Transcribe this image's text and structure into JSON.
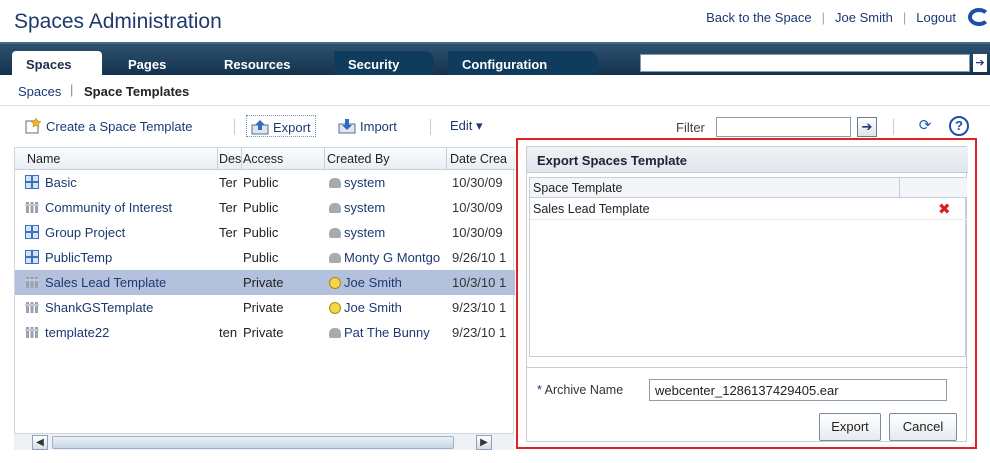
{
  "app": {
    "title": "Spaces Administration"
  },
  "header": {
    "links": [
      "Back to the Space",
      "Joe Smith",
      "Logout"
    ]
  },
  "tabs": [
    {
      "label": "Spaces"
    },
    {
      "label": "Pages"
    },
    {
      "label": "Resources"
    },
    {
      "label": "Security"
    },
    {
      "label": "Configuration"
    }
  ],
  "breadcrumb": {
    "parent": "Spaces",
    "current": "Space Templates"
  },
  "toolbar": {
    "create_label": "Create a Space Template",
    "export_label": "Export",
    "import_label": "Import",
    "edit_label": "Edit ▾",
    "filter_label": "Filter",
    "filter_value": ""
  },
  "table": {
    "columns": [
      "Name",
      "Des",
      "Access",
      "Created By",
      "Date Crea"
    ],
    "rows": [
      {
        "name": "Basic",
        "desc": "Ter",
        "access": "Public",
        "created_by": "system",
        "date": "10/30/09",
        "icon": "space-template-icon",
        "selected": false
      },
      {
        "name": "Community of Interest",
        "desc": "Ter",
        "access": "Public",
        "created_by": "system",
        "date": "10/30/09",
        "icon": "space-template-gray-icon",
        "selected": false
      },
      {
        "name": "Group Project",
        "desc": "Ter",
        "access": "Public",
        "created_by": "system",
        "date": "10/30/09",
        "icon": "space-template-icon",
        "selected": false
      },
      {
        "name": "PublicTemp",
        "desc": "",
        "access": "Public",
        "created_by": "Monty G Montgo",
        "date": "9/26/10 1",
        "icon": "space-template-icon",
        "selected": false
      },
      {
        "name": "Sales Lead Template",
        "desc": "",
        "access": "Private",
        "created_by": "Joe Smith",
        "date": "10/3/10 1",
        "icon": "space-template-gray-icon",
        "selected": true
      },
      {
        "name": "ShankGSTemplate",
        "desc": "",
        "access": "Private",
        "created_by": "Joe Smith",
        "date": "9/23/10 1",
        "icon": "space-template-gray-icon",
        "selected": false
      },
      {
        "name": "template22",
        "desc": "ten",
        "access": "Private",
        "created_by": "Pat The Bunny",
        "date": "9/23/10 1",
        "icon": "space-template-gray-icon",
        "selected": false
      }
    ]
  },
  "export_dialog": {
    "title": "Export Spaces Template",
    "table_header": "Space Template",
    "items": [
      "Sales Lead Template"
    ],
    "archive_label": "Archive Name",
    "archive_required": "*",
    "archive_value": "webcenter_1286137429405.ear",
    "export_button": "Export",
    "cancel_button": "Cancel"
  },
  "colors": {
    "accent": "#1b3972",
    "tabbar": "#14324d",
    "selected_row": "#b4c1dc",
    "highlight_border": "#e02222"
  }
}
